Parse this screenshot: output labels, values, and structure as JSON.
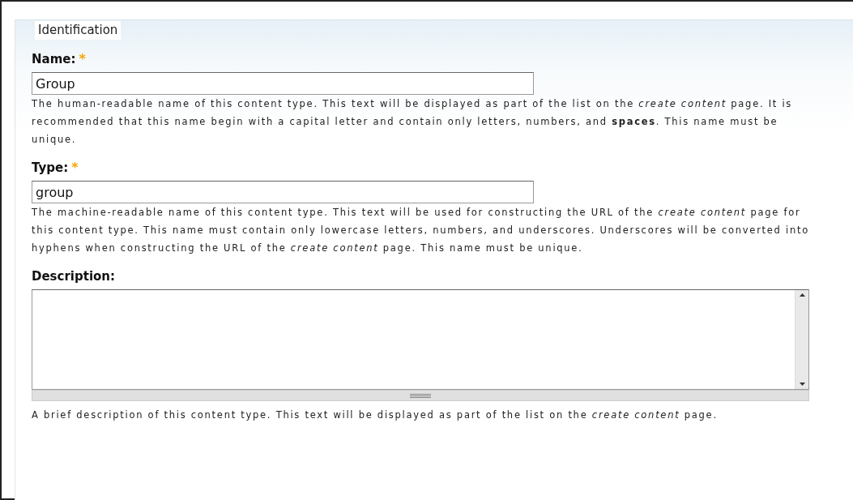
{
  "fieldset": {
    "legend": "Identification",
    "fields": [
      {
        "kind": "text",
        "label": "Name:",
        "required_mark": "*",
        "value": "Group",
        "help": "The human-readable name of this content type. This text will be displayed as part of the list on the *create content* page. It is recommended that this name begin with a capital letter and contain only letters, numbers, and **spaces**. This name must be unique."
      },
      {
        "kind": "text",
        "label": "Type:",
        "required_mark": "*",
        "value": "group",
        "help": "The machine-readable name of this content type. This text will be used for constructing the URL of the *create content* page for this content type. This name must contain only lowercase letters, numbers, and underscores. Underscores will be converted into hyphens when constructing the URL of the *create content* page. This name must be unique."
      },
      {
        "kind": "textarea",
        "label": "Description:",
        "help": "A brief description of this content type. This text will be displayed as part of the list on the *create content* page."
      }
    ]
  }
}
